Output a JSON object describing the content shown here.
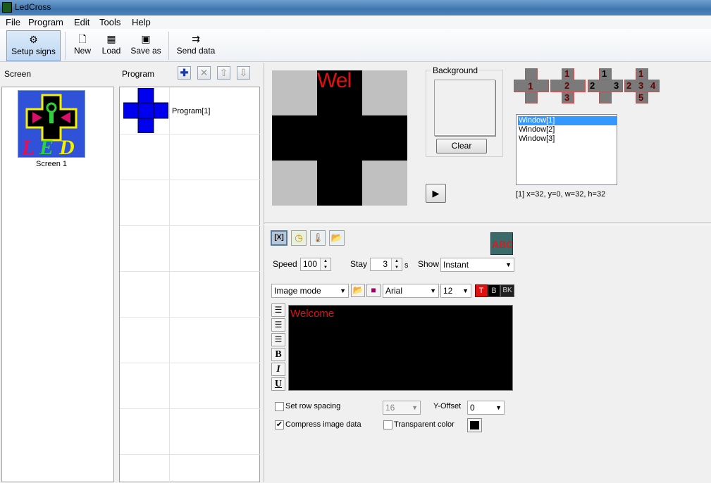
{
  "window": {
    "title": "LedCross"
  },
  "menu": [
    "File",
    "Program",
    "Edit",
    "Tools",
    "Help"
  ],
  "toolbar": {
    "setup": "Setup signs",
    "new": "New",
    "load": "Load",
    "save_as": "Save as",
    "send": "Send data"
  },
  "screen_pane": {
    "header": "Screen",
    "item_label": "Screen 1"
  },
  "program_pane": {
    "header": "Program",
    "item_label": "Program[1]"
  },
  "preview": {
    "led_text": "Wel"
  },
  "background": {
    "label": "Background",
    "clear": "Clear"
  },
  "layouts": {
    "l1": [
      "1"
    ],
    "l2": [
      "1",
      "2",
      "3"
    ],
    "l3": [
      "1",
      "2",
      "3"
    ],
    "l4": [
      "1",
      "2",
      "3",
      "4",
      "5"
    ]
  },
  "windows": {
    "items": [
      "Window[1]",
      "Window[2]",
      "Window[3]"
    ],
    "selected_index": 0,
    "info": "[1] x=32, y=0, w=32, h=32"
  },
  "effects": {
    "speed_label": "Speed",
    "speed_value": "100",
    "stay_label": "Stay",
    "stay_value": "3",
    "stay_unit": "s",
    "show_label": "Show",
    "show_value": "Instant"
  },
  "format": {
    "mode": "Image mode",
    "font": "Arial",
    "size": "12",
    "t": "T",
    "b": "B",
    "bk": "BK"
  },
  "editor": {
    "text": "Welcome",
    "text_color": "#e01010",
    "bg_color": "#000000"
  },
  "side_tools": {
    "bold": "B",
    "italic": "I",
    "underline": "U"
  },
  "options": {
    "row_spacing_label": "Set row spacing",
    "row_spacing_checked": false,
    "row_spacing_value": "16",
    "yoffset_label": "Y-Offset",
    "yoffset_value": "0",
    "compress_label": "Compress image data",
    "compress_checked": true,
    "transparent_label": "Transparent color",
    "transparent_checked": false
  },
  "colors": {
    "accent": "#3399ff",
    "led_red": "#e01010",
    "blue_cross": "#0000ee"
  }
}
